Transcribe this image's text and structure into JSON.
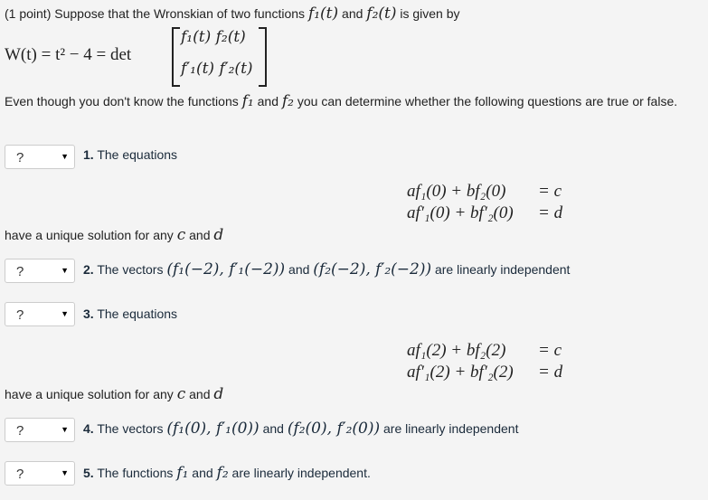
{
  "intro": {
    "prefix": "(1 point) Suppose that the Wronskian of two functions",
    "f1": "f₁(t)",
    "and": "and",
    "f2": "f₂(t)",
    "suffix": "is given by",
    "wronskian_lhs": "W(t) = t² − 4 = det",
    "matrix": {
      "r1": "f₁(t) f₂(t)",
      "r2": "f′₁(t) f′₂(t)"
    },
    "even_prefix": "Even though you don't know the functions",
    "even_f1": "f₁",
    "even_and": "and",
    "even_f2": "f₂",
    "even_suffix": "you can determine whether the following questions are true or false."
  },
  "select_value": "?",
  "questions": [
    {
      "num": "1.",
      "text": "The equations",
      "eq1": "af₁(0) + bf₂(0)",
      "eq1r": "= c",
      "eq2": "af′₁(0) + bf′₂(0)",
      "eq2r": "= d",
      "tail": "have a unique solution for any",
      "c": "c",
      "and": "and",
      "d": "d"
    },
    {
      "num": "2.",
      "text": "The vectors",
      "v1": "(f₁(−2), f′₁(−2))",
      "and": "and",
      "v2": "(f₂(−2), f′₂(−2))",
      "tail": "are linearly independent"
    },
    {
      "num": "3.",
      "text": "The equations",
      "eq1": "af₁(2) + bf₂(2)",
      "eq1r": "= c",
      "eq2": "af′₁(2) + bf′₂(2)",
      "eq2r": "= d",
      "tail": "have a unique solution for any",
      "c": "c",
      "and": "and",
      "d": "d"
    },
    {
      "num": "4.",
      "text": "The vectors",
      "v1": "(f₁(0), f′₁(0))",
      "and": "and",
      "v2": "(f₂(0), f′₂(0))",
      "tail": "are linearly independent"
    },
    {
      "num": "5.",
      "text": "The functions",
      "f1": "f₁",
      "and": "and",
      "f2": "f₂",
      "tail": "are linearly independent."
    }
  ]
}
